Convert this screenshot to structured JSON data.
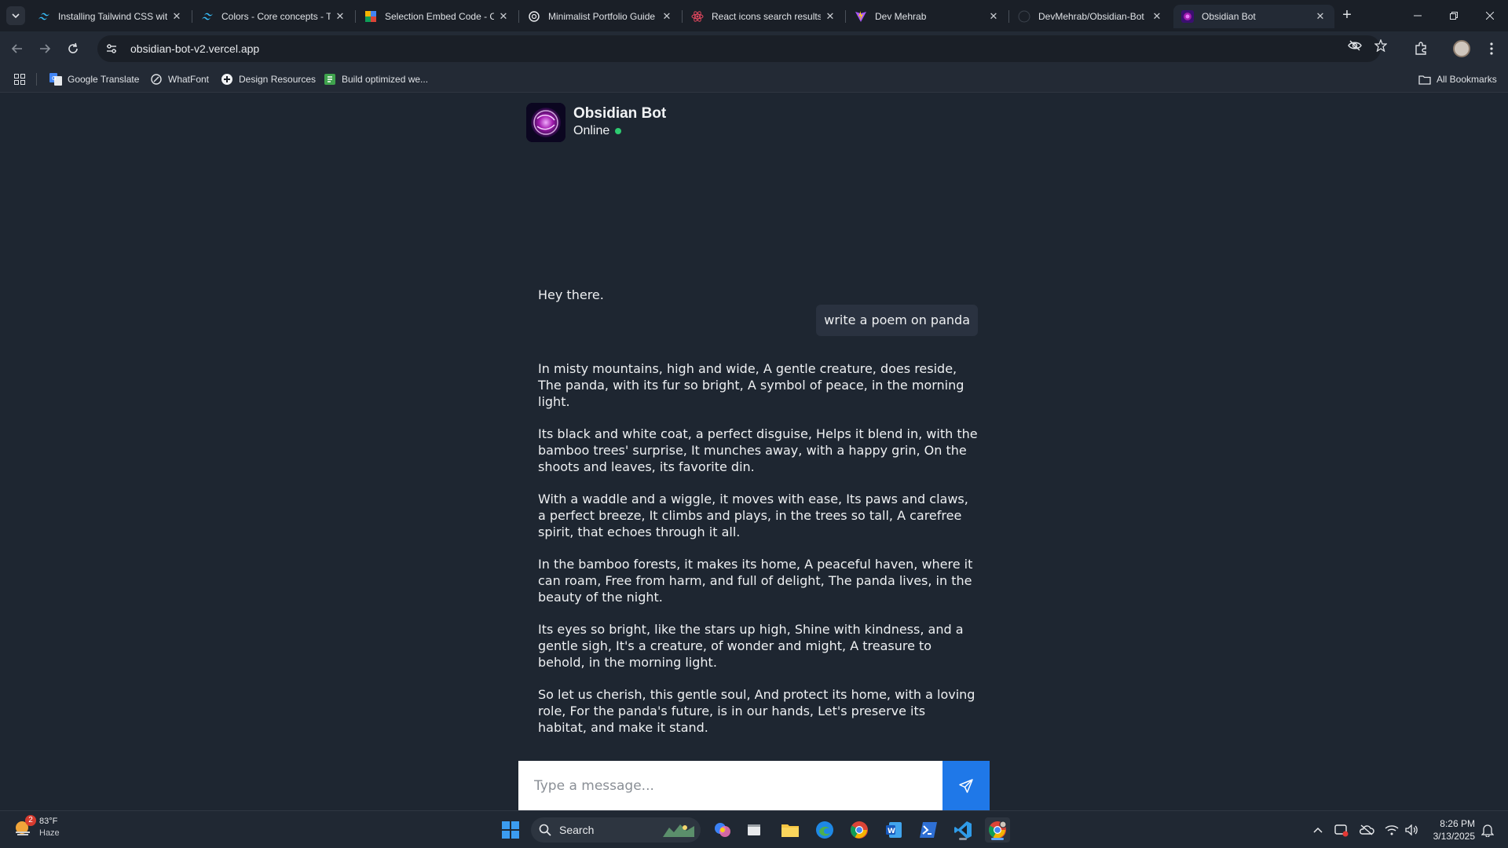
{
  "browser": {
    "tabs": [
      {
        "title": "Installing Tailwind CSS wit",
        "favicon": "tailwind-icon"
      },
      {
        "title": "Colors - Core concepts - T",
        "favicon": "tailwind-icon"
      },
      {
        "title": "Selection Embed Code - C",
        "favicon": "codepen-colored-icon"
      },
      {
        "title": "Minimalist Portfolio Guide",
        "favicon": "chatgpt-icon"
      },
      {
        "title": "React icons search results",
        "favicon": "react-icons-icon"
      },
      {
        "title": "Dev Mehrab",
        "favicon": "vite-icon"
      },
      {
        "title": "DevMehrab/Obsidian-Bot",
        "favicon": "github-icon"
      },
      {
        "title": "Obsidian Bot",
        "favicon": "obsidian-icon"
      }
    ],
    "active_tab_index": 7,
    "url": "obsidian-bot-v2.vercel.app",
    "bookmarks": [
      {
        "label": "Google Translate",
        "icon": "google-translate-icon"
      },
      {
        "label": "WhatFont",
        "icon": "whatfont-icon"
      },
      {
        "label": "Design Resources",
        "icon": "design-resources-icon"
      },
      {
        "label": "Build optimized we...",
        "icon": "build-icon"
      }
    ],
    "all_bookmarks_label": "All Bookmarks"
  },
  "chat": {
    "bot_name": "Obsidian Bot",
    "status": "Online",
    "status_color": "#2ecc71",
    "greeting": "Hey there.",
    "user_message": "write a poem on panda",
    "poem_stanzas": [
      "In misty mountains, high and wide, A gentle creature, does reside, The panda, with its fur so bright, A symbol of peace, in the morning light.",
      "Its black and white coat, a perfect disguise, Helps it blend in, with the bamboo trees' surprise, It munches away, with a happy grin, On the shoots and leaves, its favorite din.",
      "With a waddle and a wiggle, it moves with ease, Its paws and claws, a perfect breeze, It climbs and plays, in the trees so tall, A carefree spirit, that echoes through it all.",
      "In the bamboo forests, it makes its home, A peaceful haven, where it can roam, Free from harm, and full of delight, The panda lives, in the beauty of the night.",
      "Its eyes so bright, like the stars up high, Shine with kindness, and a gentle sigh, It's a creature, of wonder and might, A treasure to behold, in the morning light.",
      "So let us cherish, this gentle soul, And protect its home, with a loving role, For the panda's future, is in our hands, Let's preserve its habitat, and make it stand."
    ],
    "input_placeholder": "Type a message...",
    "send_color": "#1f78e8"
  },
  "taskbar": {
    "weather_temp": "83°F",
    "weather_desc": "Haze",
    "weather_badge": "2",
    "search_label": "Search",
    "time": "8:26 PM",
    "date": "3/13/2025"
  }
}
